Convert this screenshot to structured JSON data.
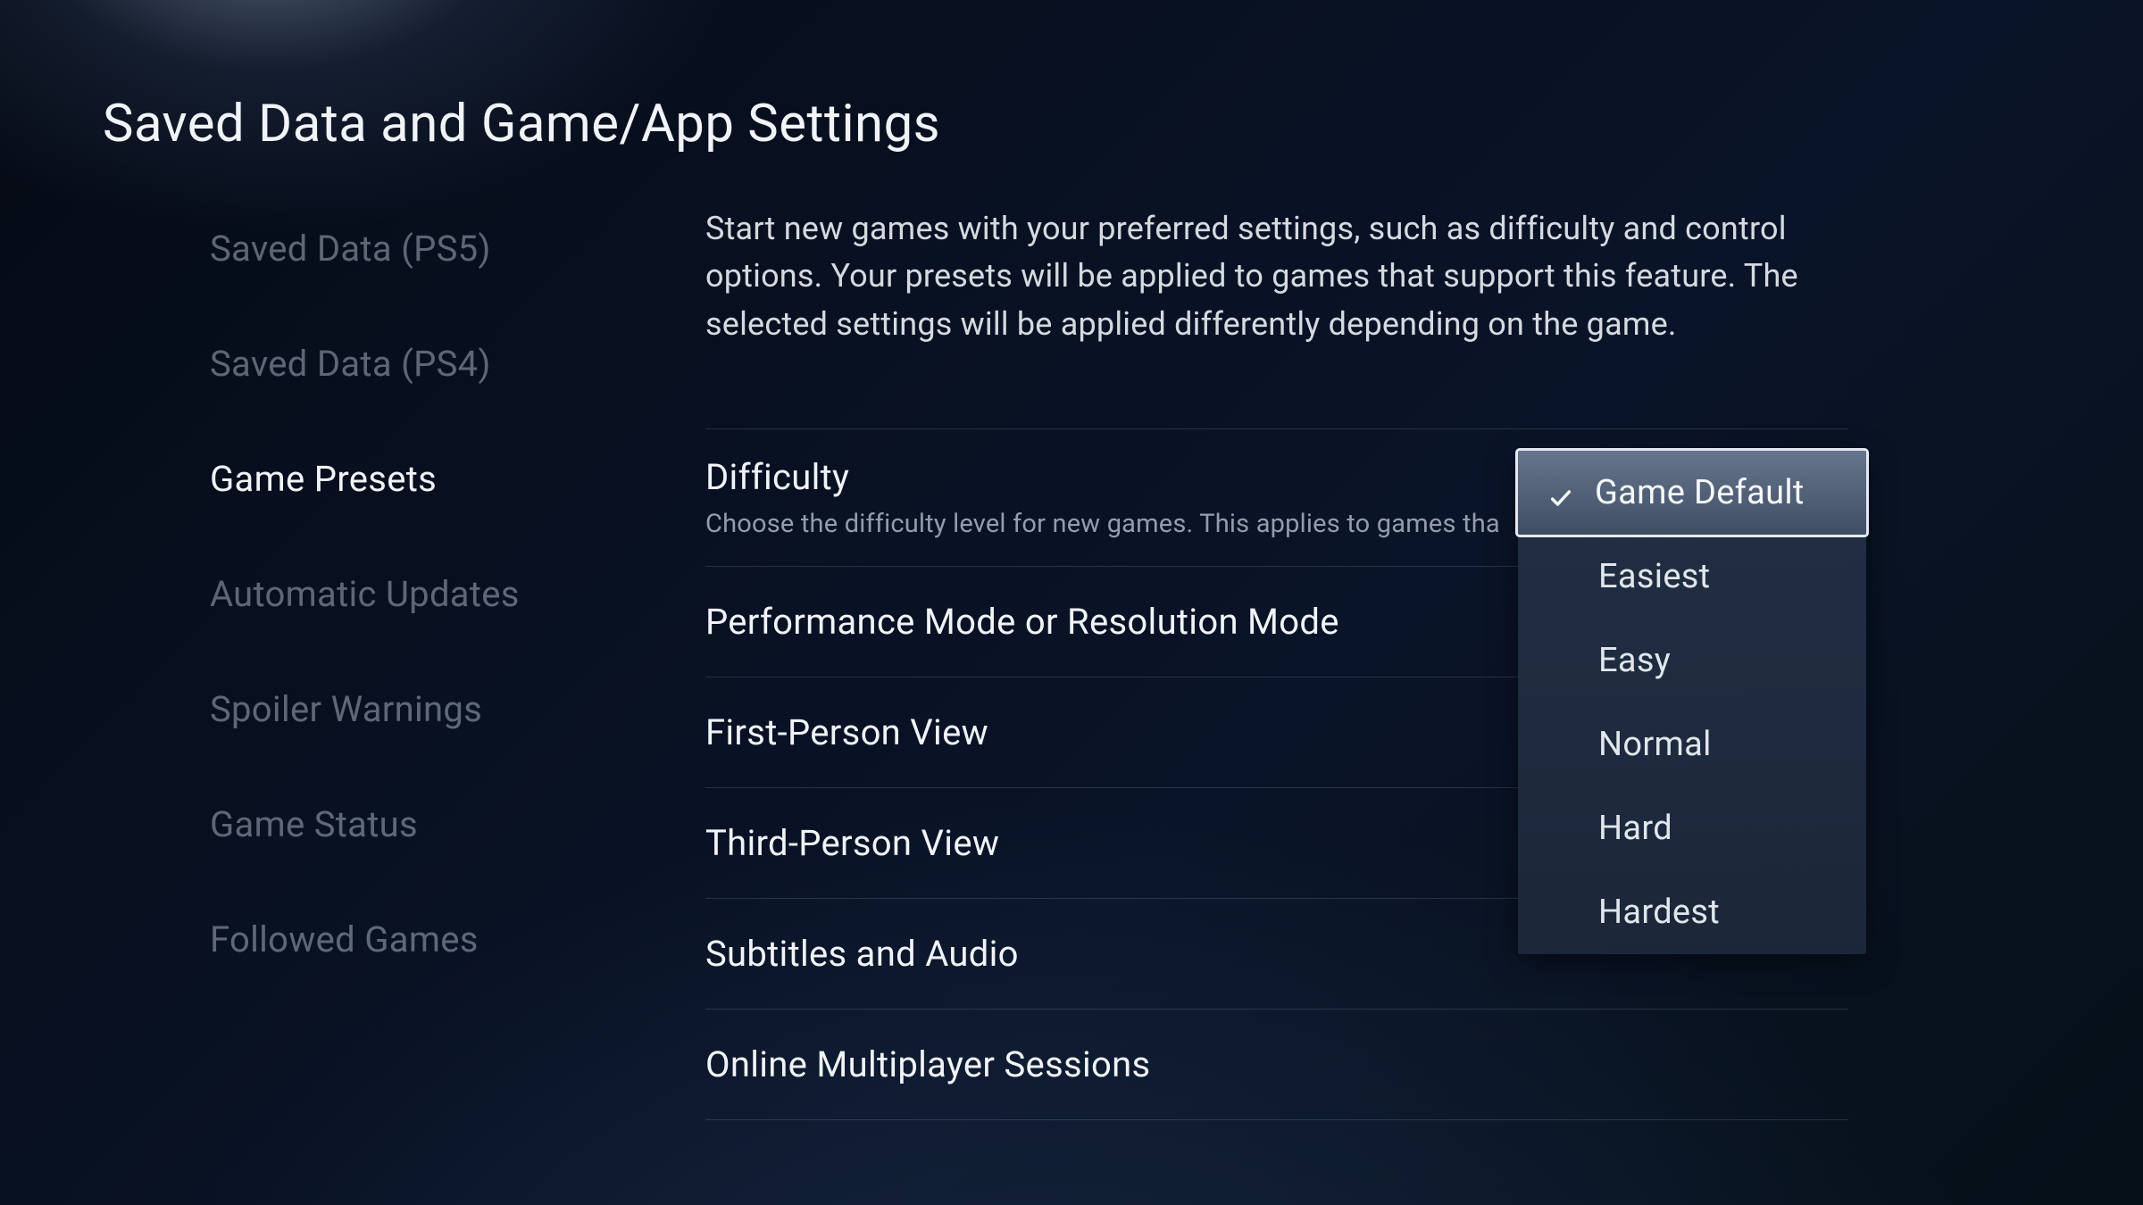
{
  "page_title": "Saved Data and Game/App Settings",
  "sidebar": {
    "items": [
      {
        "label": "Saved Data (PS5)",
        "active": false
      },
      {
        "label": "Saved Data (PS4)",
        "active": false
      },
      {
        "label": "Game Presets",
        "active": true
      },
      {
        "label": "Automatic Updates",
        "active": false
      },
      {
        "label": "Spoiler Warnings",
        "active": false
      },
      {
        "label": "Game Status",
        "active": false
      },
      {
        "label": "Followed Games",
        "active": false
      }
    ]
  },
  "main": {
    "description": "Start new games with your preferred settings, such as difficulty and control options. Your presets will be applied to games that support this feature. The selected settings will be applied differently depending on the game.",
    "settings": [
      {
        "title": "Difficulty",
        "subtitle": "Choose the difficulty level for new games. This applies to games tha"
      },
      {
        "title": "Performance Mode or Resolution Mode"
      },
      {
        "title": "First-Person View"
      },
      {
        "title": "Third-Person View"
      },
      {
        "title": "Subtitles and Audio"
      },
      {
        "title": "Online Multiplayer Sessions"
      }
    ]
  },
  "dropdown": {
    "options": [
      {
        "label": "Game Default",
        "selected": true
      },
      {
        "label": "Easiest",
        "selected": false
      },
      {
        "label": "Easy",
        "selected": false
      },
      {
        "label": "Normal",
        "selected": false
      },
      {
        "label": "Hard",
        "selected": false
      },
      {
        "label": "Hardest",
        "selected": false
      }
    ]
  }
}
